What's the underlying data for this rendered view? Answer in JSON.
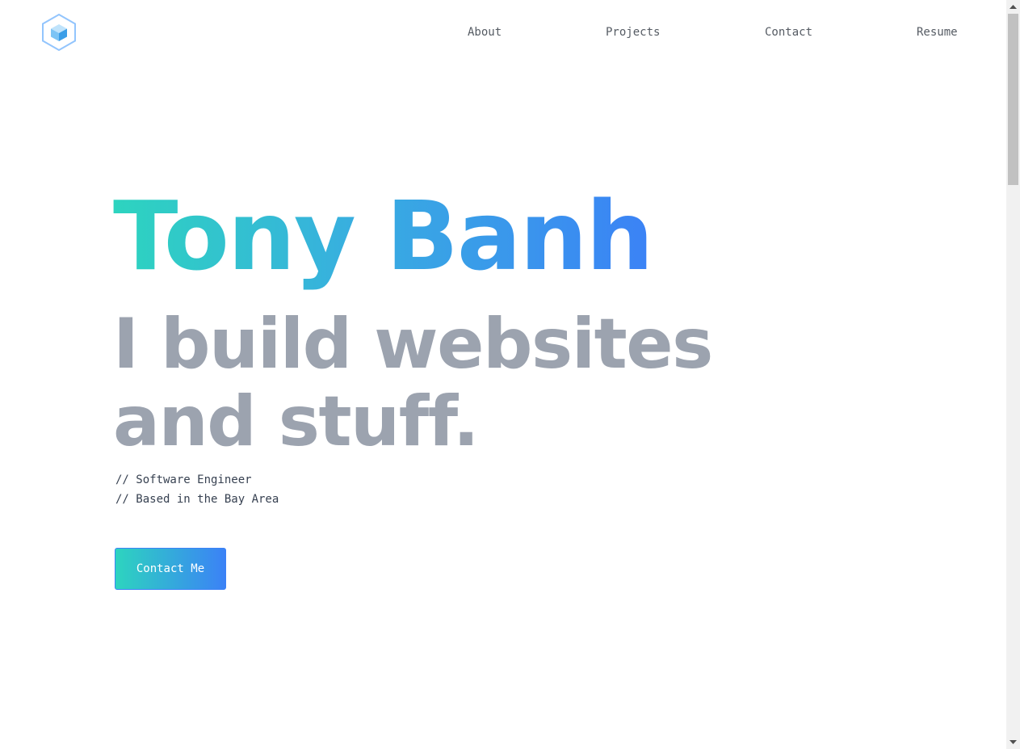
{
  "logo": {
    "icon": "hexagon-cube-logo-icon",
    "colors": {
      "outline": "#93c5fd",
      "light": "#bfe3fb",
      "mid": "#7cc4f5",
      "dark": "#3b9ee8"
    }
  },
  "nav": {
    "items": [
      {
        "label": "About"
      },
      {
        "label": "Projects"
      },
      {
        "label": "Contact"
      },
      {
        "label": "Resume"
      }
    ]
  },
  "hero": {
    "name": "Tony Banh",
    "tagline": "I build websites and stuff.",
    "lines": [
      "// Software Engineer",
      "// Based in the Bay Area"
    ],
    "cta_label": "Contact Me"
  },
  "colors": {
    "gradient_start": "#2dd4bf",
    "gradient_end": "#3b82f6",
    "tagline": "#9ca3af",
    "nav_text": "#555b63"
  }
}
